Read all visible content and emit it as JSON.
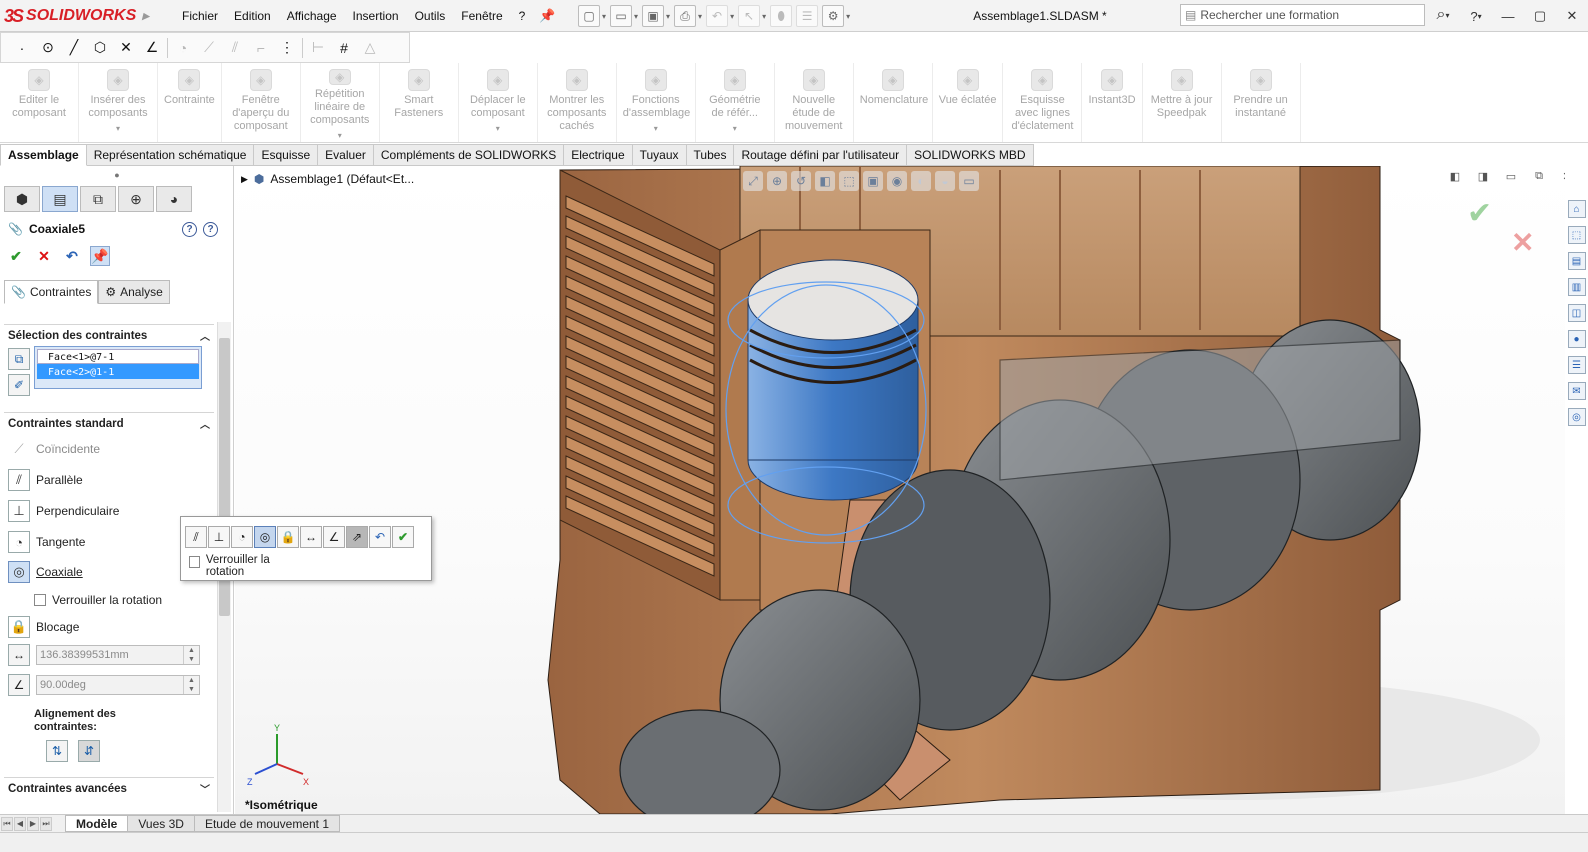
{
  "window": {
    "brand_ds": "3S",
    "brand_name": "SOLIDWORKS",
    "document_title": "Assemblage1.SLDASM *",
    "search_placeholder": "Rechercher une formation",
    "help_label": "?"
  },
  "menus": [
    "Fichier",
    "Edition",
    "Affichage",
    "Insertion",
    "Outils",
    "Fenêtre",
    "?"
  ],
  "commands": [
    {
      "label": "Editer le composant",
      "icon": "edit-component-icon",
      "dropdown": false
    },
    {
      "label": "Insérer des composants",
      "icon": "insert-components-icon",
      "dropdown": true
    },
    {
      "label": "Contrainte",
      "icon": "mate-icon",
      "dropdown": false
    },
    {
      "label": "Fenêtre d'aperçu du composant",
      "icon": "component-preview-icon",
      "dropdown": false
    },
    {
      "label": "Répétition linéaire de composants",
      "icon": "linear-pattern-icon",
      "dropdown": true
    },
    {
      "label": "Smart Fasteners",
      "icon": "smart-fasteners-icon",
      "dropdown": false
    },
    {
      "label": "Déplacer le composant",
      "icon": "move-component-icon",
      "dropdown": true
    },
    {
      "label": "Montrer les composants cachés",
      "icon": "show-hidden-icon",
      "dropdown": false
    },
    {
      "label": "Fonctions d'assemblage",
      "icon": "assembly-features-icon",
      "dropdown": true
    },
    {
      "label": "Géométrie de référ...",
      "icon": "reference-geometry-icon",
      "dropdown": true
    },
    {
      "label": "Nouvelle étude de mouvement",
      "icon": "motion-study-icon",
      "dropdown": false
    },
    {
      "label": "Nomenclature",
      "icon": "bom-icon",
      "dropdown": false
    },
    {
      "label": "Vue éclatée",
      "icon": "exploded-view-icon",
      "dropdown": false
    },
    {
      "label": "Esquisse avec lignes d'éclatement",
      "icon": "explode-line-icon",
      "dropdown": false
    },
    {
      "label": "Instant3D",
      "icon": "instant3d-icon",
      "dropdown": false
    },
    {
      "label": "Mettre à jour Speedpak",
      "icon": "speedpak-icon",
      "dropdown": false
    },
    {
      "label": "Prendre un instantané",
      "icon": "snapshot-icon",
      "dropdown": false
    }
  ],
  "tabs": [
    "Assemblage",
    "Représentation schématique",
    "Esquisse",
    "Evaluer",
    "Compléments de SOLIDWORKS",
    "Electrique",
    "Tuyaux",
    "Tubes",
    "Routage défini par l'utilisateur",
    "SOLIDWORKS MBD"
  ],
  "active_tab": "Assemblage",
  "property_manager": {
    "title": "Coaxiale5",
    "subtabs": [
      "Contraintes",
      "Analyse"
    ],
    "selection_header": "Sélection des contraintes",
    "selections": [
      "Face<1>@7-1",
      "Face<2>@1-1"
    ],
    "standard_header": "Contraintes standard",
    "mates": {
      "coincidence": "Coïncidente",
      "parallel": "Parallèle",
      "perpendicular": "Perpendiculaire",
      "tangent": "Tangente",
      "coaxial": "Coaxiale",
      "lock_rotation": "Verrouiller la rotation",
      "lock": "Blocage"
    },
    "distance_value": "136.38399531mm",
    "angle_value": "90.00deg",
    "alignment_label": "Alignement des contraintes:",
    "advanced_header": "Contraintes avancées"
  },
  "tree": {
    "root": "Assemblage1  (Défaut<Et..."
  },
  "popup": {
    "lock_rotation_label": "Verrouiller la rotation"
  },
  "viewport": {
    "view_name": "*Isométrique",
    "triad_y": "Y",
    "triad_x": "X",
    "triad_z": "Z"
  },
  "bottom_tabs": [
    "Modèle",
    "Vues 3D",
    "Etude de mouvement 1"
  ],
  "active_bottom_tab": "Modèle",
  "colors": {
    "brand_red": "#d81f26",
    "selection_blue": "#3399ff",
    "casing_copper": "#b07a4e",
    "crank_gray": "#6f7377",
    "piston_blue": "#3d78c4"
  }
}
